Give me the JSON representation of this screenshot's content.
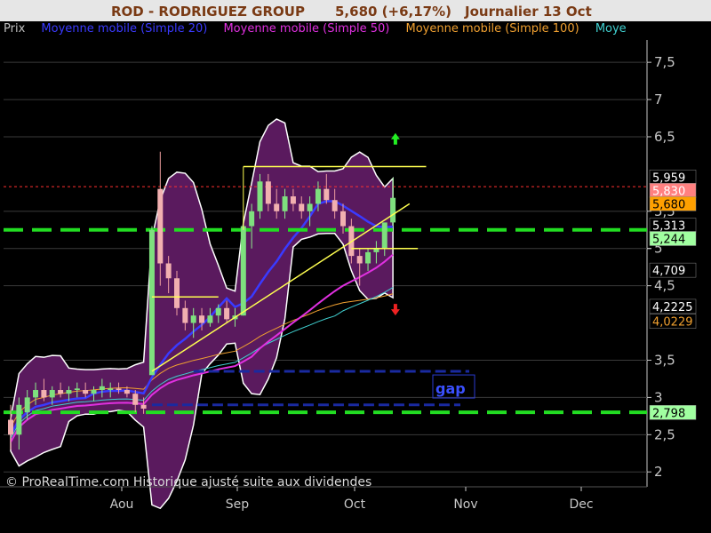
{
  "header": {
    "ticker": "ROD - RODRIGUEZ GROUP",
    "price_change": "5,680 (+6,17%)",
    "period": "Journalier  13 Oct"
  },
  "legend": [
    {
      "label": "Prix",
      "color": "#c0c0c0"
    },
    {
      "label": "Moyenne mobile (Simple 20)",
      "color": "#3a3aff"
    },
    {
      "label": "Moyenne mobile (Simple 50)",
      "color": "#e030e0"
    },
    {
      "label": "Moyenne mobile (Simple 100)",
      "color": "#f0a030"
    },
    {
      "label": "Moye",
      "color": "#40d0d0"
    }
  ],
  "footer": "© ProRealTime.com Historique ajusté suite aux dividendes",
  "annotations": {
    "gap_label": "gap"
  },
  "chart_data": {
    "type": "line",
    "y_ticks": [
      "7,5",
      "7",
      "6,5",
      "5,5",
      "5",
      "4,5",
      "3,5",
      "3",
      "2,5",
      "2"
    ],
    "x_ticks": [
      "Aou",
      "Sep",
      "Oct",
      "Nov",
      "Dec"
    ],
    "ylim": [
      1.8,
      7.8
    ],
    "grid": true,
    "price_markers": [
      {
        "label": "5,959",
        "value": 5.959,
        "bg": "#000000",
        "fg": "#ffffff"
      },
      {
        "label": "5,830",
        "value": 5.83,
        "bg": "#ff8080",
        "fg": "#ffffff"
      },
      {
        "label": "5,680",
        "value": 5.68,
        "bg": "#ffa000",
        "fg": "#000000"
      },
      {
        "label": "5,313",
        "value": 5.313,
        "bg": "#000000",
        "fg": "#ffffff"
      },
      {
        "label": "5,244",
        "value": 5.244,
        "bg": "#a0ffa0",
        "fg": "#000000"
      },
      {
        "label": "4,709",
        "value": 4.709,
        "bg": "#000000",
        "fg": "#ffffff"
      },
      {
        "label": "4,2225",
        "value": 4.2225,
        "bg": "#000000",
        "fg": "#ffffff"
      },
      {
        "label": "4,0229",
        "value": 4.0229,
        "bg": "#000000",
        "fg": "#f0a030"
      },
      {
        "label": "2,798",
        "value": 2.798,
        "bg": "#a0ffa0",
        "fg": "#000000"
      }
    ],
    "support_levels": [
      5.25,
      2.8
    ],
    "resistance_level": 5.83,
    "candles": [
      {
        "d": 0,
        "o": 2.7,
        "h": 2.9,
        "l": 2.3,
        "c": 2.5
      },
      {
        "d": 1,
        "o": 2.5,
        "h": 3.0,
        "l": 2.3,
        "c": 2.9
      },
      {
        "d": 2,
        "o": 2.8,
        "h": 3.1,
        "l": 2.7,
        "c": 3.0
      },
      {
        "d": 3,
        "o": 3.0,
        "h": 3.2,
        "l": 2.9,
        "c": 3.1
      },
      {
        "d": 4,
        "o": 3.1,
        "h": 3.25,
        "l": 2.95,
        "c": 3.0
      },
      {
        "d": 5,
        "o": 3.0,
        "h": 3.15,
        "l": 2.9,
        "c": 3.1
      },
      {
        "d": 6,
        "o": 3.1,
        "h": 3.2,
        "l": 3.0,
        "c": 3.05
      },
      {
        "d": 7,
        "o": 3.05,
        "h": 3.15,
        "l": 2.95,
        "c": 3.1
      },
      {
        "d": 8,
        "o": 3.1,
        "h": 3.2,
        "l": 3.0,
        "c": 3.12
      },
      {
        "d": 9,
        "o": 3.1,
        "h": 3.2,
        "l": 3.0,
        "c": 3.05
      },
      {
        "d": 10,
        "o": 3.05,
        "h": 3.15,
        "l": 2.95,
        "c": 3.1
      },
      {
        "d": 11,
        "o": 3.1,
        "h": 3.25,
        "l": 3.0,
        "c": 3.15
      },
      {
        "d": 12,
        "o": 3.1,
        "h": 3.2,
        "l": 3.0,
        "c": 3.12
      },
      {
        "d": 13,
        "o": 3.12,
        "h": 3.2,
        "l": 3.05,
        "c": 3.1
      },
      {
        "d": 14,
        "o": 3.1,
        "h": 3.15,
        "l": 3.0,
        "c": 3.05
      },
      {
        "d": 15,
        "o": 3.05,
        "h": 3.1,
        "l": 2.8,
        "c": 2.9
      },
      {
        "d": 16,
        "o": 2.9,
        "h": 3.0,
        "l": 2.78,
        "c": 2.85
      },
      {
        "d": 17,
        "o": 3.3,
        "h": 5.3,
        "l": 3.3,
        "c": 5.25
      },
      {
        "d": 18,
        "o": 5.8,
        "h": 6.3,
        "l": 4.5,
        "c": 4.8
      },
      {
        "d": 19,
        "o": 4.8,
        "h": 4.9,
        "l": 4.4,
        "c": 4.6
      },
      {
        "d": 20,
        "o": 4.6,
        "h": 4.7,
        "l": 4.1,
        "c": 4.2
      },
      {
        "d": 21,
        "o": 4.2,
        "h": 4.3,
        "l": 3.9,
        "c": 4.0
      },
      {
        "d": 22,
        "o": 4.0,
        "h": 4.2,
        "l": 3.8,
        "c": 4.1
      },
      {
        "d": 23,
        "o": 4.1,
        "h": 4.2,
        "l": 3.9,
        "c": 4.0
      },
      {
        "d": 24,
        "o": 4.0,
        "h": 4.2,
        "l": 3.95,
        "c": 4.1
      },
      {
        "d": 25,
        "o": 4.1,
        "h": 4.25,
        "l": 4.0,
        "c": 4.2
      },
      {
        "d": 26,
        "o": 4.2,
        "h": 4.3,
        "l": 4.0,
        "c": 4.05
      },
      {
        "d": 27,
        "o": 4.05,
        "h": 4.2,
        "l": 3.95,
        "c": 4.1
      },
      {
        "d": 28,
        "o": 4.1,
        "h": 5.4,
        "l": 4.1,
        "c": 5.3
      },
      {
        "d": 29,
        "o": 5.3,
        "h": 5.6,
        "l": 5.0,
        "c": 5.5
      },
      {
        "d": 30,
        "o": 5.5,
        "h": 6.0,
        "l": 5.4,
        "c": 5.9
      },
      {
        "d": 31,
        "o": 5.9,
        "h": 6.0,
        "l": 5.5,
        "c": 5.6
      },
      {
        "d": 32,
        "o": 5.6,
        "h": 5.8,
        "l": 5.4,
        "c": 5.5
      },
      {
        "d": 33,
        "o": 5.5,
        "h": 5.8,
        "l": 5.4,
        "c": 5.7
      },
      {
        "d": 34,
        "o": 5.7,
        "h": 5.8,
        "l": 5.5,
        "c": 5.6
      },
      {
        "d": 35,
        "o": 5.6,
        "h": 5.7,
        "l": 5.4,
        "c": 5.5
      },
      {
        "d": 36,
        "o": 5.5,
        "h": 5.7,
        "l": 5.3,
        "c": 5.6
      },
      {
        "d": 37,
        "o": 5.6,
        "h": 5.9,
        "l": 5.5,
        "c": 5.8
      },
      {
        "d": 38,
        "o": 5.8,
        "h": 6.0,
        "l": 5.6,
        "c": 5.65
      },
      {
        "d": 39,
        "o": 5.65,
        "h": 5.8,
        "l": 5.4,
        "c": 5.5
      },
      {
        "d": 40,
        "o": 5.5,
        "h": 5.6,
        "l": 5.2,
        "c": 5.3
      },
      {
        "d": 41,
        "o": 5.3,
        "h": 5.4,
        "l": 4.8,
        "c": 4.9
      },
      {
        "d": 42,
        "o": 4.9,
        "h": 5.0,
        "l": 4.5,
        "c": 4.8
      },
      {
        "d": 43,
        "o": 4.8,
        "h": 5.0,
        "l": 4.7,
        "c": 4.95
      },
      {
        "d": 44,
        "o": 4.95,
        "h": 5.1,
        "l": 4.8,
        "c": 5.0
      },
      {
        "d": 45,
        "o": 5.0,
        "h": 5.2,
        "l": 4.9,
        "c": 5.35
      },
      {
        "d": 46,
        "o": 5.35,
        "h": 5.95,
        "l": 5.3,
        "c": 5.68
      }
    ]
  }
}
